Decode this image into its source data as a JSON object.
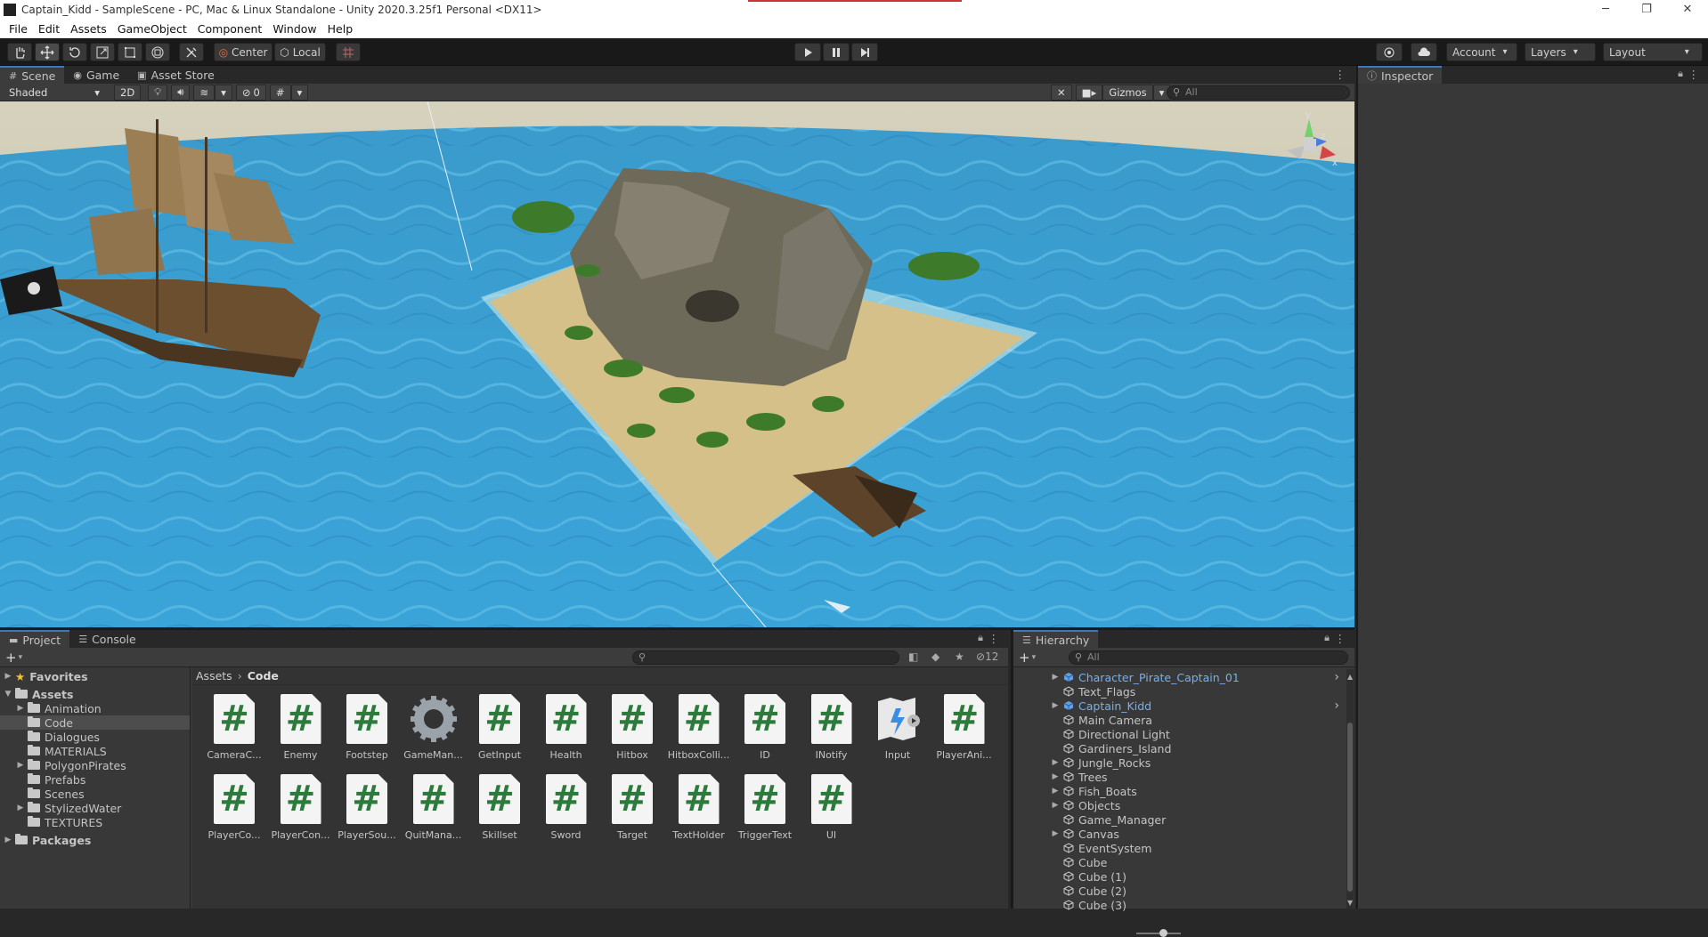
{
  "window": {
    "title": "Captain_Kidd - SampleScene - PC, Mac & Linux Standalone - Unity 2020.3.25f1 Personal <DX11>",
    "minimize": "─",
    "maximize": "❐",
    "close": "✕"
  },
  "menu": [
    "File",
    "Edit",
    "Assets",
    "GameObject",
    "Component",
    "Window",
    "Help"
  ],
  "toolbar": {
    "pivot": "Center",
    "space": "Local",
    "account": "Account",
    "layers": "Layers",
    "layout": "Layout"
  },
  "scene_tabs": {
    "scene": "Scene",
    "game": "Game",
    "asset_store": "Asset Store"
  },
  "scene_bar": {
    "shading": "Shaded",
    "mode_2d": "2D",
    "hidden_count": "0",
    "gizmos": "Gizmos",
    "search_placeholder": "All"
  },
  "inspector": {
    "title": "Inspector"
  },
  "project_tabs": {
    "project": "Project",
    "console": "Console"
  },
  "project": {
    "hidden_count": "12",
    "breadcrumb": [
      "Assets",
      "Code"
    ],
    "tree": [
      {
        "label": "Favorites",
        "bold": true,
        "indent": 0,
        "fold": "▶",
        "star": true
      },
      {
        "label": "Assets",
        "bold": true,
        "indent": 0,
        "fold": "▼"
      },
      {
        "label": "Animation",
        "indent": 1,
        "fold": "▶"
      },
      {
        "label": "Code",
        "indent": 1,
        "fold": "",
        "selected": true
      },
      {
        "label": "Dialogues",
        "indent": 1,
        "fold": ""
      },
      {
        "label": "MATERIALS",
        "indent": 1,
        "fold": ""
      },
      {
        "label": "PolygonPirates",
        "indent": 1,
        "fold": "▶"
      },
      {
        "label": "Prefabs",
        "indent": 1,
        "fold": ""
      },
      {
        "label": "Scenes",
        "indent": 1,
        "fold": ""
      },
      {
        "label": "StylizedWater",
        "indent": 1,
        "fold": "▶"
      },
      {
        "label": "TEXTURES",
        "indent": 1,
        "fold": ""
      },
      {
        "label": "Packages",
        "bold": true,
        "indent": 0,
        "fold": "▶"
      }
    ],
    "assets": [
      {
        "name": "CameraC...",
        "type": "script"
      },
      {
        "name": "Enemy",
        "type": "script"
      },
      {
        "name": "Footstep",
        "type": "script"
      },
      {
        "name": "GameMan...",
        "type": "gear"
      },
      {
        "name": "GetInput",
        "type": "script"
      },
      {
        "name": "Health",
        "type": "script"
      },
      {
        "name": "Hitbox",
        "type": "script"
      },
      {
        "name": "HitboxColli...",
        "type": "script"
      },
      {
        "name": "ID",
        "type": "script"
      },
      {
        "name": "INotify",
        "type": "script"
      },
      {
        "name": "Input",
        "type": "input"
      },
      {
        "name": "PlayerAni...",
        "type": "script"
      },
      {
        "name": "PlayerCo...",
        "type": "script"
      },
      {
        "name": "PlayerCon...",
        "type": "script"
      },
      {
        "name": "PlayerSou...",
        "type": "script"
      },
      {
        "name": "QuitMana...",
        "type": "script"
      },
      {
        "name": "Skillset",
        "type": "script"
      },
      {
        "name": "Sword",
        "type": "script"
      },
      {
        "name": "Target",
        "type": "script"
      },
      {
        "name": "TextHolder",
        "type": "script"
      },
      {
        "name": "TriggerText",
        "type": "script"
      },
      {
        "name": "UI",
        "type": "script"
      }
    ],
    "script_glyph": "#"
  },
  "hierarchy": {
    "title": "Hierarchy",
    "search_placeholder": "All",
    "items": [
      {
        "label": "Character_Pirate_Captain_01",
        "fold": "▶",
        "prefab": true,
        "arrow": "›"
      },
      {
        "label": "Text_Flags",
        "fold": ""
      },
      {
        "label": "Captain_Kidd",
        "fold": "▶",
        "prefab": true,
        "arrow": "›"
      },
      {
        "label": "Main Camera",
        "fold": ""
      },
      {
        "label": "Directional Light",
        "fold": ""
      },
      {
        "label": "Gardiners_Island",
        "fold": ""
      },
      {
        "label": "Jungle_Rocks",
        "fold": "▶"
      },
      {
        "label": "Trees",
        "fold": "▶"
      },
      {
        "label": "Fish_Boats",
        "fold": "▶"
      },
      {
        "label": "Objects",
        "fold": "▶"
      },
      {
        "label": "Game_Manager",
        "fold": ""
      },
      {
        "label": "Canvas",
        "fold": "▶"
      },
      {
        "label": "EventSystem",
        "fold": ""
      },
      {
        "label": "Cube",
        "fold": ""
      },
      {
        "label": "Cube (1)",
        "fold": ""
      },
      {
        "label": "Cube (2)",
        "fold": ""
      },
      {
        "label": "Cube (3)",
        "fold": ""
      }
    ]
  },
  "gizmo_axes": {
    "y": "y",
    "z": "z",
    "x": "x"
  },
  "colors": {
    "accent": "#3a79bb",
    "prefab": "#7aaef0",
    "script_hash": "#2c7a3c",
    "water": "#3ea0d0"
  }
}
